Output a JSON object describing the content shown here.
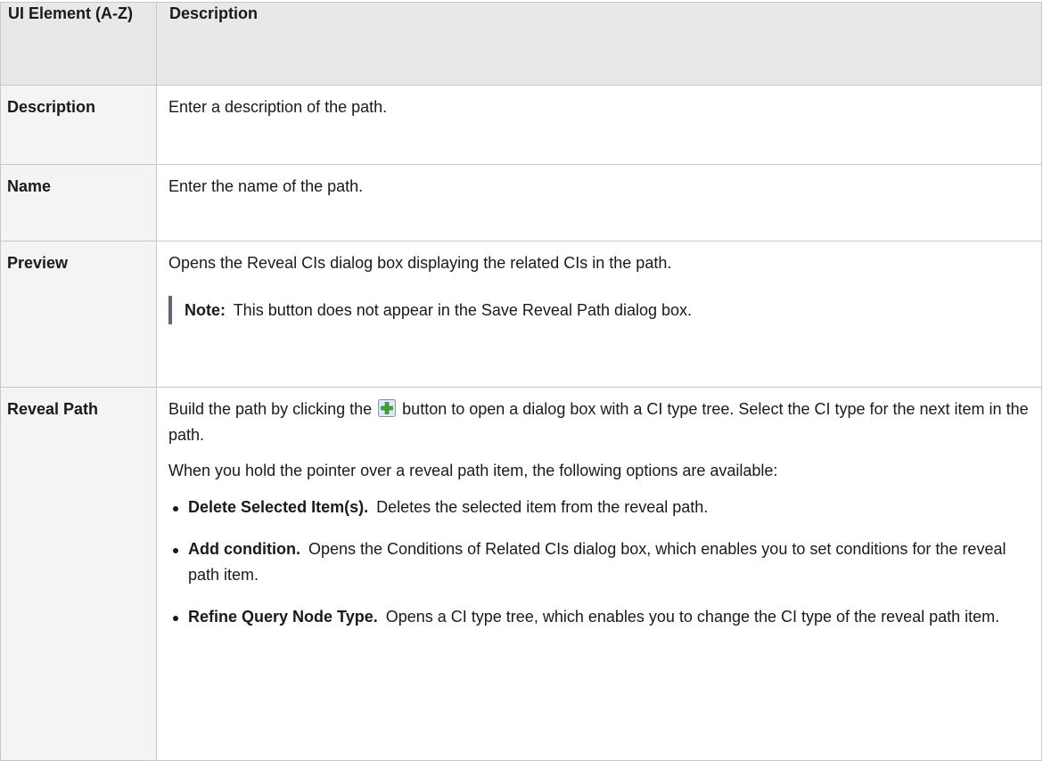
{
  "table": {
    "header": {
      "col1": "UI Element (A-Z)",
      "col2": "Description"
    },
    "rows": [
      {
        "label": "Description",
        "text": "Enter a description of the path."
      },
      {
        "label": "Name",
        "text": "Enter the name of the path."
      },
      {
        "label": "Preview",
        "text": "Opens the Reveal CIs dialog box displaying the related CIs in the path.",
        "note_label": "Note:",
        "note_text": "This button does not appear in the Save Reveal Path dialog box."
      },
      {
        "label": "Reveal Path",
        "text_before_icon": "Build the path by clicking the",
        "icon": "add-plus-icon",
        "text_after_icon": "button to open a dialog box with a CI type tree. Select the CI type for the next item in the path.",
        "hover_text": "When you hold the pointer over a reveal path item, the following options are available:",
        "options": [
          {
            "title": "Delete Selected Item(s).",
            "text": "Deletes the selected item from the reveal path."
          },
          {
            "title": "Add condition.",
            "text": "Opens the Conditions of Related CIs dialog box, which enables you to set conditions for the reveal path item."
          },
          {
            "title": "Refine Query Node Type.",
            "text": "Opens a CI type tree, which enables you to change the CI type of the reveal path item."
          }
        ]
      }
    ]
  },
  "colors": {
    "header_bg": "#e8e8e8",
    "label_bg": "#f4f4f4",
    "border": "#c8c8c8",
    "note_bar": "#6c5f7f",
    "icon_green": "#3fa535"
  }
}
